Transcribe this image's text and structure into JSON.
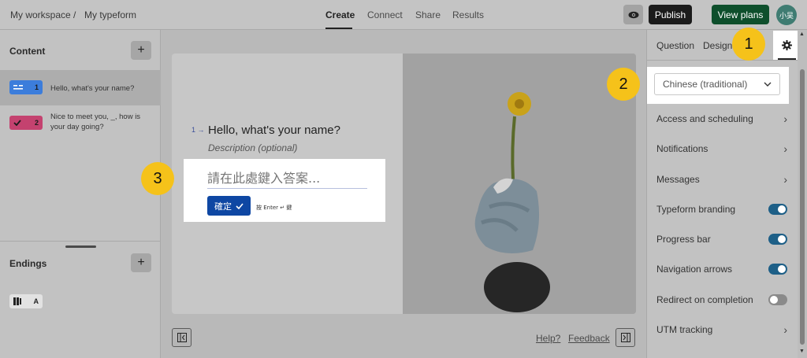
{
  "header": {
    "workspace": "My workspace",
    "separator": "/",
    "form_name": "My typeform",
    "tabs": [
      "Create",
      "Connect",
      "Share",
      "Results"
    ],
    "active_tab": "Create",
    "publish_label": "Publish",
    "view_plans_label": "View plans",
    "avatar_text": "小吴"
  },
  "sidebar": {
    "content_title": "Content",
    "questions": [
      {
        "number": "1",
        "text": "Hello, what's your name?",
        "color": "#3c7ddb"
      },
      {
        "number": "2",
        "text": "Nice to meet you, _, how is your day going?",
        "color": "#c4426f"
      }
    ],
    "endings_title": "Endings",
    "ending_badge": "A"
  },
  "canvas": {
    "q_number": "1",
    "q_arrow": "→",
    "question": "Hello, what's your name?",
    "description": "Description (optional)",
    "answer_placeholder": "請在此處鍵入答案...",
    "confirm_label": "確定",
    "enter_hint": "按 Enter ↵ 鍵",
    "help_link": "Help?",
    "feedback_link": "Feedback"
  },
  "right_panel": {
    "tabs": [
      "Question",
      "Design"
    ],
    "language_value": "Chinese (traditional)",
    "rows": [
      {
        "label": "Access and scheduling",
        "kind": "chevron"
      },
      {
        "label": "Notifications",
        "kind": "chevron"
      },
      {
        "label": "Messages",
        "kind": "chevron"
      },
      {
        "label": "Typeform branding",
        "kind": "toggle",
        "on": true
      },
      {
        "label": "Progress bar",
        "kind": "toggle",
        "on": true
      },
      {
        "label": "Navigation arrows",
        "kind": "toggle",
        "on": true
      },
      {
        "label": "Redirect on completion",
        "kind": "toggle",
        "on": false
      },
      {
        "label": "UTM tracking",
        "kind": "chevron"
      }
    ]
  },
  "callouts": [
    "1",
    "2",
    "3"
  ],
  "colors": {
    "publish": "#1b1b1b",
    "view_plans": "#0e4f2c",
    "confirm": "#0e47a3",
    "toggle_on": "#1d5f87",
    "callout": "#f5c21a"
  }
}
